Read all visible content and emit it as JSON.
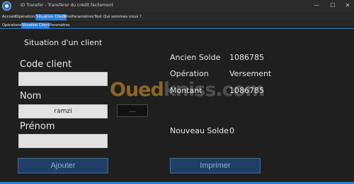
{
  "window": {
    "title": "ID Transfer - Transférer du crédit facilement",
    "minimize": "—",
    "maximize": "☐",
    "close": "✕"
  },
  "menu": {
    "items": [
      {
        "label": "Accueil"
      },
      {
        "label": "Opérations"
      },
      {
        "label": "Situation Client"
      },
      {
        "label": "Sms"
      },
      {
        "label": "Paramètres"
      },
      {
        "label": "Test"
      },
      {
        "label": "Qui sommes nous ?"
      }
    ],
    "active": "Situation Client"
  },
  "tabs": {
    "items": [
      {
        "label": "Opérations"
      },
      {
        "label": "Situation Client"
      },
      {
        "label": "Paramètres"
      }
    ],
    "active": "Situation Client"
  },
  "form": {
    "section_title": "Situation d'un client",
    "code_client": {
      "label": "Code client",
      "value": ""
    },
    "nom": {
      "label": "Nom",
      "value": "ramzi"
    },
    "prenom": {
      "label": "Prénom",
      "value": ""
    },
    "browse_button": "....",
    "add_button": "Ajouter"
  },
  "summary": {
    "ancien_solde": {
      "label": "Ancien Solde",
      "value": "1086785"
    },
    "operation": {
      "label": "Opération",
      "value": "Versement"
    },
    "montant": {
      "label": "Montant",
      "value": "1086785"
    },
    "nouveau_solde": {
      "label": "Nouveau Solde",
      "value": "0"
    },
    "print_button": "Imprimer"
  },
  "watermark": {
    "text_a": "Oued",
    "text_b": "kniss",
    "text_c": ".com"
  },
  "colors": {
    "accent": "#2f7fd0",
    "background": "#1e1e1e",
    "button_fill": "#1f3f66"
  }
}
